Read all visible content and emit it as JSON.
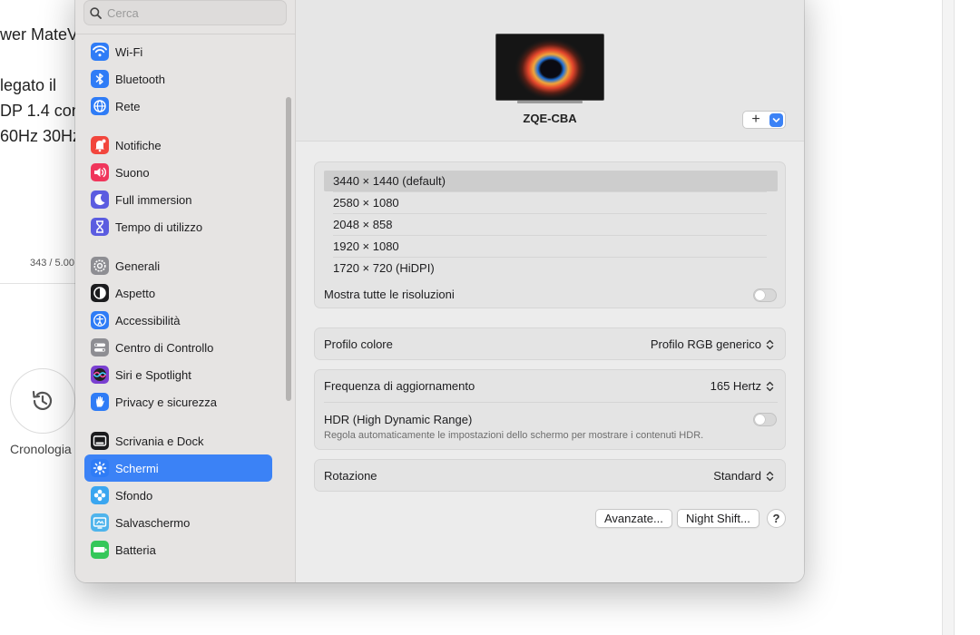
{
  "background_page": {
    "lines": [
      "wer MateV",
      "legato il",
      "DP 1.4 con",
      "60Hz 30Hz"
    ],
    "counter": "343 / 5.00",
    "history_label": "Cronologia"
  },
  "sidebar": {
    "search_placeholder": "Cerca",
    "items": [
      {
        "label": "Wi-Fi",
        "icon": "wifi-icon",
        "color": "#2f7cf6"
      },
      {
        "label": "Bluetooth",
        "icon": "bluetooth-icon",
        "color": "#2f7cf6"
      },
      {
        "label": "Rete",
        "icon": "globe-icon",
        "color": "#2f7cf6"
      },
      {
        "label": "Notifiche",
        "icon": "bell-icon",
        "color": "#f2463d"
      },
      {
        "label": "Suono",
        "icon": "speaker-icon",
        "color": "#f0365b"
      },
      {
        "label": "Full immersion",
        "icon": "moon-icon",
        "color": "#5b5ce0"
      },
      {
        "label": "Tempo di utilizzo",
        "icon": "hourglass-icon",
        "color": "#5b5ce0"
      },
      {
        "label": "Generali",
        "icon": "gear-icon",
        "color": "#8e8e93"
      },
      {
        "label": "Aspetto",
        "icon": "appearance-icon",
        "color": "#1c1c1e"
      },
      {
        "label": "Accessibilità",
        "icon": "accessibility-icon",
        "color": "#2f7cf6"
      },
      {
        "label": "Centro di Controllo",
        "icon": "control-center-icon",
        "color": "#8e8e93"
      },
      {
        "label": "Siri e Spotlight",
        "icon": "siri-icon",
        "color": "#7a3fd1"
      },
      {
        "label": "Privacy e sicurezza",
        "icon": "hand-icon",
        "color": "#2f7cf6"
      },
      {
        "label": "Scrivania e Dock",
        "icon": "dock-icon",
        "color": "#1c1c1e"
      },
      {
        "label": "Schermi",
        "icon": "sun-icon",
        "color": "#2f7cf6",
        "selected": true
      },
      {
        "label": "Sfondo",
        "icon": "flower-icon",
        "color": "#3aa6f0"
      },
      {
        "label": "Salvaschermo",
        "icon": "screensaver-icon",
        "color": "#4fb4ec"
      },
      {
        "label": "Batteria",
        "icon": "battery-icon",
        "color": "#35c759"
      }
    ]
  },
  "display": {
    "name": "ZQE-CBA",
    "add_label": "+"
  },
  "resolutions": {
    "options": [
      "3440 × 1440 (default)",
      "2580 × 1080",
      "2048 × 858",
      "1920 × 1080",
      "1720 × 720 (HiDPI)"
    ],
    "selected_index": 0,
    "show_all_label": "Mostra tutte le risoluzioni",
    "show_all_on": false
  },
  "color_profile": {
    "label": "Profilo colore",
    "value": "Profilo RGB generico"
  },
  "refresh": {
    "label": "Frequenza di aggiornamento",
    "value": "165 Hertz"
  },
  "hdr": {
    "label": "HDR (High Dynamic Range)",
    "description": "Regola automaticamente le impostazioni dello schermo per mostrare i contenuti HDR.",
    "on": false
  },
  "rotation": {
    "label": "Rotazione",
    "value": "Standard"
  },
  "buttons": {
    "advanced": "Avanzate...",
    "night_shift": "Night Shift...",
    "help": "?"
  }
}
